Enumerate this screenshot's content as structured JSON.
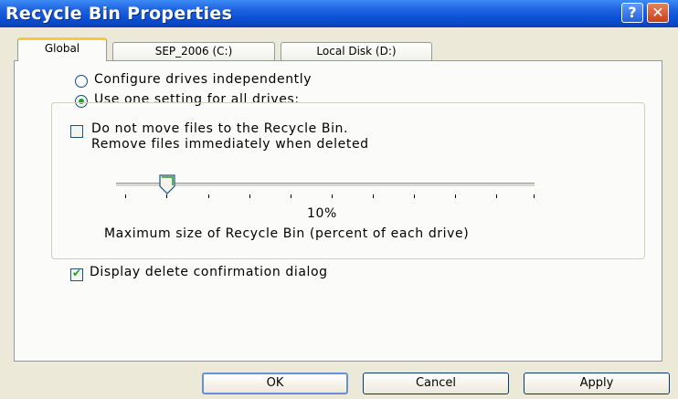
{
  "window": {
    "title": "Recycle Bin Properties",
    "help_label": "?",
    "close_label": "✕"
  },
  "tabs": [
    {
      "label": "Global",
      "active": true
    },
    {
      "label": "SEP_2006 (C:)",
      "active": false
    },
    {
      "label": "Local Disk (D:)",
      "active": false
    }
  ],
  "options": {
    "configure_independently": "Configure drives independently",
    "use_one_setting": "Use one setting for all drives:",
    "selected": "use_one_setting"
  },
  "group": {
    "no_recycle_line1": "Do not move files to the Recycle Bin.",
    "no_recycle_line2": "Remove files immediately when deleted",
    "no_recycle_checked": false,
    "slider_value": 10,
    "slider_label": "10%",
    "max_size_caption": "Maximum size of Recycle Bin (percent of each drive)"
  },
  "confirm": {
    "label": "Display delete confirmation dialog",
    "checked": true
  },
  "buttons": {
    "ok": "OK",
    "cancel": "Cancel",
    "apply": "Apply"
  },
  "colors": {
    "title_bar": "#0a4fd3",
    "active_tab_highlight": "#ffc83c",
    "check_green": "#21a121"
  }
}
